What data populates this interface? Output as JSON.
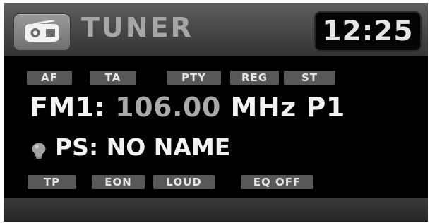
{
  "header": {
    "app_icon": "radio-icon",
    "title": "TUNER",
    "clock": "12:25"
  },
  "status_flags": {
    "row1": [
      "AF",
      "TA",
      "PTY",
      "REG",
      "ST"
    ],
    "row2": [
      "TP",
      "EON",
      "LOUD",
      "EQ OFF"
    ]
  },
  "tuner": {
    "band": "FM1:",
    "frequency": "106.00",
    "unit": "MHz",
    "preset": "P1"
  },
  "ps": {
    "icon": "bulb-icon",
    "label": "PS: NO NAME"
  },
  "colors": {
    "background": "#000000",
    "header": "#4a4a4a",
    "frequency_value": "#a9a9a9",
    "badge": "#585858"
  }
}
